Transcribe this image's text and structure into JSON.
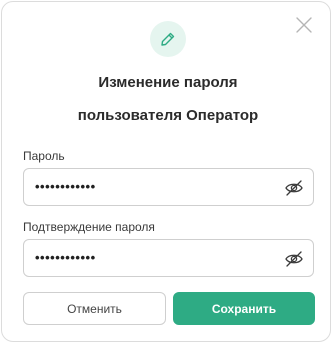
{
  "dialog": {
    "title_line1": "Изменение пароля",
    "title_line2": "пользователя Оператор",
    "header_icon": "pencil-icon",
    "close_icon": "close-icon"
  },
  "password": {
    "label": "Пароль",
    "value": "••••••••••••",
    "toggle_icon": "eye-off-icon"
  },
  "confirm": {
    "label": "Подтверждение пароля",
    "value": "••••••••••••",
    "toggle_icon": "eye-off-icon"
  },
  "buttons": {
    "cancel": "Отменить",
    "save": "Сохранить"
  },
  "colors": {
    "accent": "#2eab84",
    "icon_bg": "#e5f5ef",
    "border": "#cfcfcf"
  }
}
